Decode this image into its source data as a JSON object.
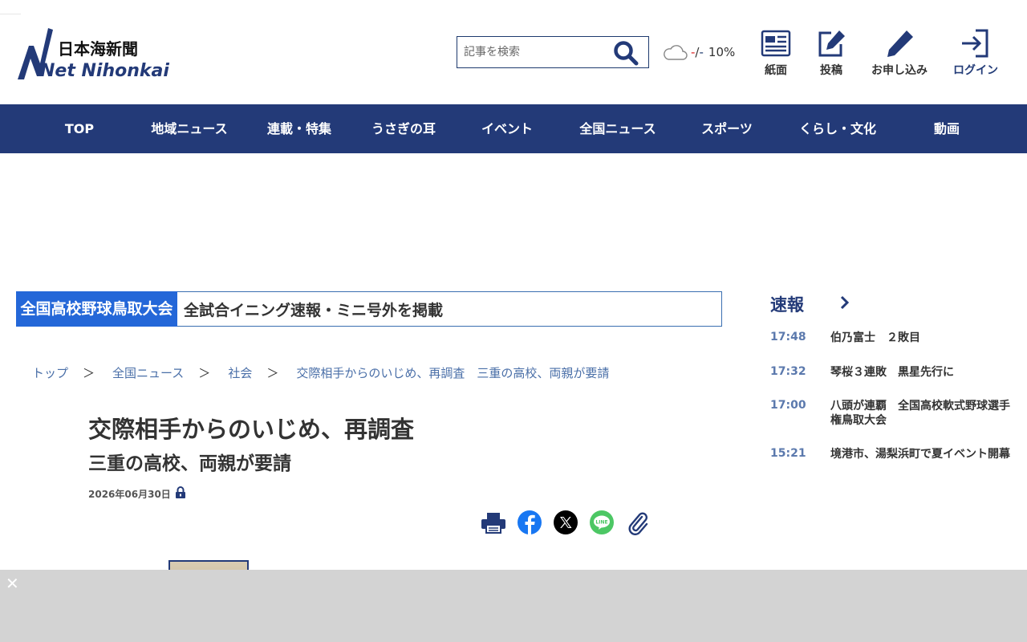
{
  "header": {
    "logo_text_jp": "日本海新聞",
    "logo_text_en": "Net Nihonkai",
    "search": {
      "placeholder": "記事を検索",
      "value": ""
    },
    "weather": {
      "icon": "cloud-icon",
      "high": "-",
      "sep": "/",
      "low": "-",
      "rain": "10%"
    },
    "links": [
      {
        "label": "紙面",
        "icon": "newspaper-icon"
      },
      {
        "label": "投稿",
        "icon": "post-icon"
      },
      {
        "label": "お申し込み",
        "icon": "pencil-icon"
      },
      {
        "label": "ログイン",
        "icon": "login-icon"
      }
    ]
  },
  "nav": {
    "items": [
      "TOP",
      "地域ニュース",
      "連載・特集",
      "うさぎの耳",
      "イベント",
      "全国ニュース",
      "スポーツ",
      "くらし・文化",
      "動画"
    ]
  },
  "banner": {
    "tag": "全国高校野球鳥取大会",
    "text": "全試合イニング速報・ミニ号外を掲載"
  },
  "breadcrumb": {
    "items": [
      "トップ",
      "全国ニュース",
      "社会",
      "交際相手からのいじめ、再調査　三重の高校、両親が要請"
    ],
    "separator": "＞"
  },
  "article": {
    "title": "交際相手からのいじめ、再調査",
    "subtitle": "三重の高校、両親が要請",
    "date": "2026年06月30日",
    "share_icons": [
      "print-icon",
      "facebook-icon",
      "x-icon",
      "line-icon",
      "clip-icon"
    ]
  },
  "sidebar": {
    "heading": "速報",
    "items": [
      {
        "time": "17:48",
        "headline": "伯乃富士　２敗目"
      },
      {
        "time": "17:32",
        "headline": "琴桜３連敗　黒星先行に"
      },
      {
        "time": "17:00",
        "headline": "八頭が連覇　全国高校軟式野球選手権鳥取大会"
      },
      {
        "time": "15:21",
        "headline": "境港市、湯梨浜町で夏イベント開幕"
      }
    ]
  },
  "overlay": {
    "close_label": "✕"
  },
  "colors": {
    "brand": "#233a78",
    "banner_tag": "#2467d8",
    "link": "#4a6fa8"
  }
}
